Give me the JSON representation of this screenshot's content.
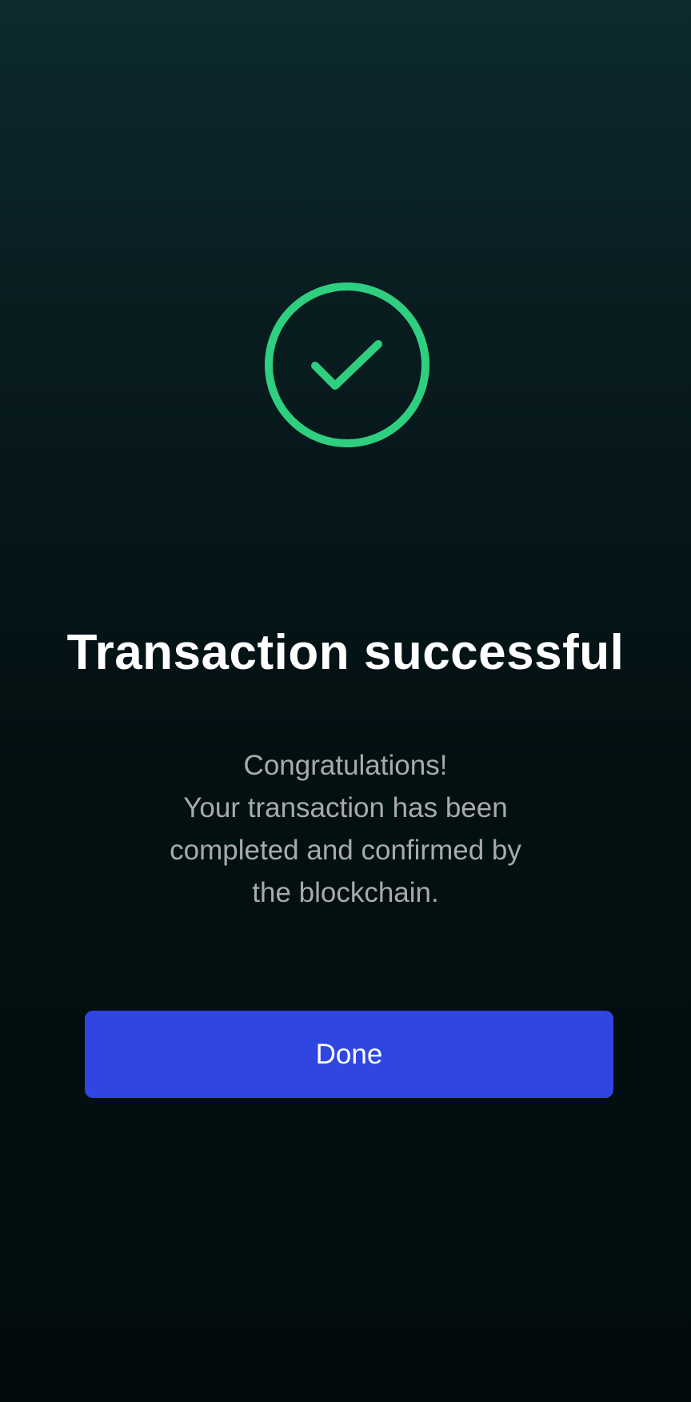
{
  "success": {
    "icon": "check-circle-icon",
    "color": "#2fcf80"
  },
  "title": "Transaction successful",
  "message": {
    "line1": "Congratulations!",
    "line2": "Your transaction has been",
    "line3": "completed and confirmed by",
    "line4": "the blockchain."
  },
  "actions": {
    "done_label": "Done",
    "done_color": "#2f47e0"
  }
}
